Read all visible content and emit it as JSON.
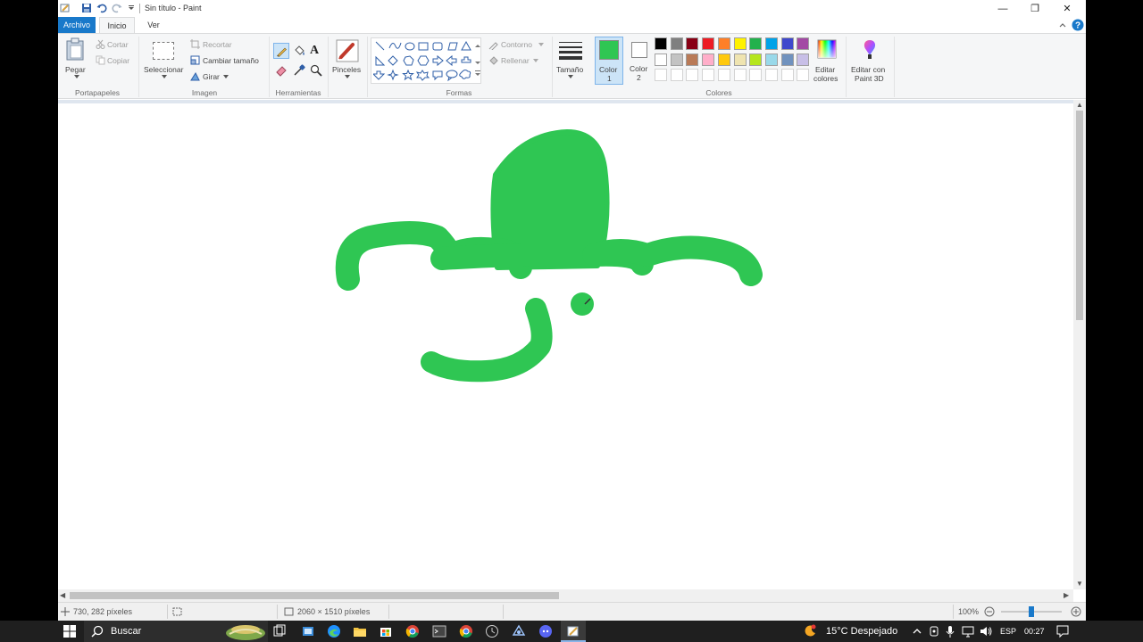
{
  "window": {
    "title": "Sin título - Paint",
    "minimize_glyph": "—",
    "maximize_glyph": "❐",
    "close_glyph": "✕"
  },
  "tabs": [
    {
      "label": "Archivo",
      "active": false
    },
    {
      "label": "Inicio",
      "active": true
    },
    {
      "label": "Ver",
      "active": false
    }
  ],
  "ribbon": {
    "portapapeles": {
      "group": "Portapapeles",
      "pegar": "Pegar",
      "cortar": "Cortar",
      "copiar": "Copiar"
    },
    "imagen": {
      "group": "Imagen",
      "seleccionar": "Seleccionar",
      "recortar": "Recortar",
      "cambiar_tamano": "Cambiar tamaño",
      "girar": "Girar"
    },
    "herramientas": {
      "group": "Herramientas",
      "text_tool": "A"
    },
    "pinceles": {
      "label": "Pinceles"
    },
    "formas": {
      "group": "Formas",
      "contorno": "Contorno",
      "rellenar": "Rellenar"
    },
    "tamano": {
      "label": "Tamaño"
    },
    "color1": {
      "label_line1": "Color",
      "label_line2": "1",
      "value": "#2fc653"
    },
    "color2": {
      "label_line1": "Color",
      "label_line2": "2",
      "value": "#ffffff"
    },
    "colores": {
      "group": "Colores",
      "palette_row1": [
        "#000000",
        "#7f7f7f",
        "#880015",
        "#ed1c24",
        "#ff7f27",
        "#fff200",
        "#22b14c",
        "#00a2e8",
        "#3f48cc",
        "#a349a4"
      ],
      "palette_row2": [
        "#ffffff",
        "#c3c3c3",
        "#b97a57",
        "#ffaec9",
        "#ffc90e",
        "#efe4b0",
        "#b5e61d",
        "#99d9ea",
        "#7092be",
        "#c8bfe7"
      ],
      "editar_colores": [
        "Editar",
        "colores"
      ],
      "paint3d": [
        "Editar con",
        "Paint 3D"
      ]
    }
  },
  "canvas": {
    "stroke_color": "#2fc653"
  },
  "statusbar": {
    "cursor_pos": "730, 282 píxeles",
    "image_size": "2060 × 1510 píxeles",
    "zoom": "100%",
    "zoom_level": 0.5
  },
  "taskbar": {
    "search_label": "Buscar",
    "weather": "15°C  Despejado",
    "language": "ESP",
    "time": "00:27"
  }
}
